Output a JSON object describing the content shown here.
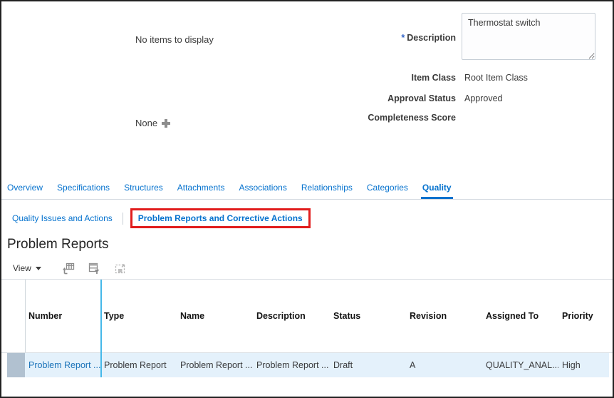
{
  "top": {
    "empty_message": "No items to display",
    "attachments_value": "None",
    "fields": {
      "description": {
        "required_marker": "*",
        "label": "Description",
        "value": "Thermostat switch"
      },
      "item_class": {
        "label": "Item Class",
        "value": "Root Item Class"
      },
      "approval_status": {
        "label": "Approval Status",
        "value": "Approved"
      },
      "completeness_score": {
        "label": "Completeness Score",
        "value": ""
      }
    }
  },
  "tabs": {
    "items": [
      {
        "label": "Overview"
      },
      {
        "label": "Specifications"
      },
      {
        "label": "Structures"
      },
      {
        "label": "Attachments"
      },
      {
        "label": "Associations"
      },
      {
        "label": "Relationships"
      },
      {
        "label": "Categories"
      },
      {
        "label": "Quality"
      }
    ],
    "active": "Quality"
  },
  "subtabs": {
    "items": [
      {
        "label": "Quality Issues and Actions"
      },
      {
        "label": "Problem Reports and Corrective Actions"
      }
    ],
    "active": "Problem Reports and Corrective Actions",
    "annotation": "red-highlight-box"
  },
  "section": {
    "heading": "Problem Reports"
  },
  "toolbar": {
    "view_label": "View",
    "icons": [
      "export-icon",
      "query-by-example-icon",
      "detach-icon"
    ]
  },
  "table": {
    "columns": [
      {
        "label": "Number"
      },
      {
        "label": "Type"
      },
      {
        "label": "Name"
      },
      {
        "label": "Description"
      },
      {
        "label": "Status"
      },
      {
        "label": "Revision"
      },
      {
        "label": "Assigned To"
      },
      {
        "label": "Priority"
      }
    ],
    "rows": [
      {
        "cells": [
          "Problem Report ...",
          "Problem Report",
          "Problem Report ...",
          "Problem Report ...",
          "Draft",
          "A",
          "QUALITY_ANAL...",
          "High"
        ]
      }
    ]
  },
  "colors": {
    "accent_blue": "#0572ce",
    "link_blue": "#1b73b9",
    "highlight_red": "#e11c1c",
    "selected_row_bg": "#e4f1fb",
    "row_selector_bg": "#b1c1d0",
    "column_highlight": "#45b8e9"
  }
}
